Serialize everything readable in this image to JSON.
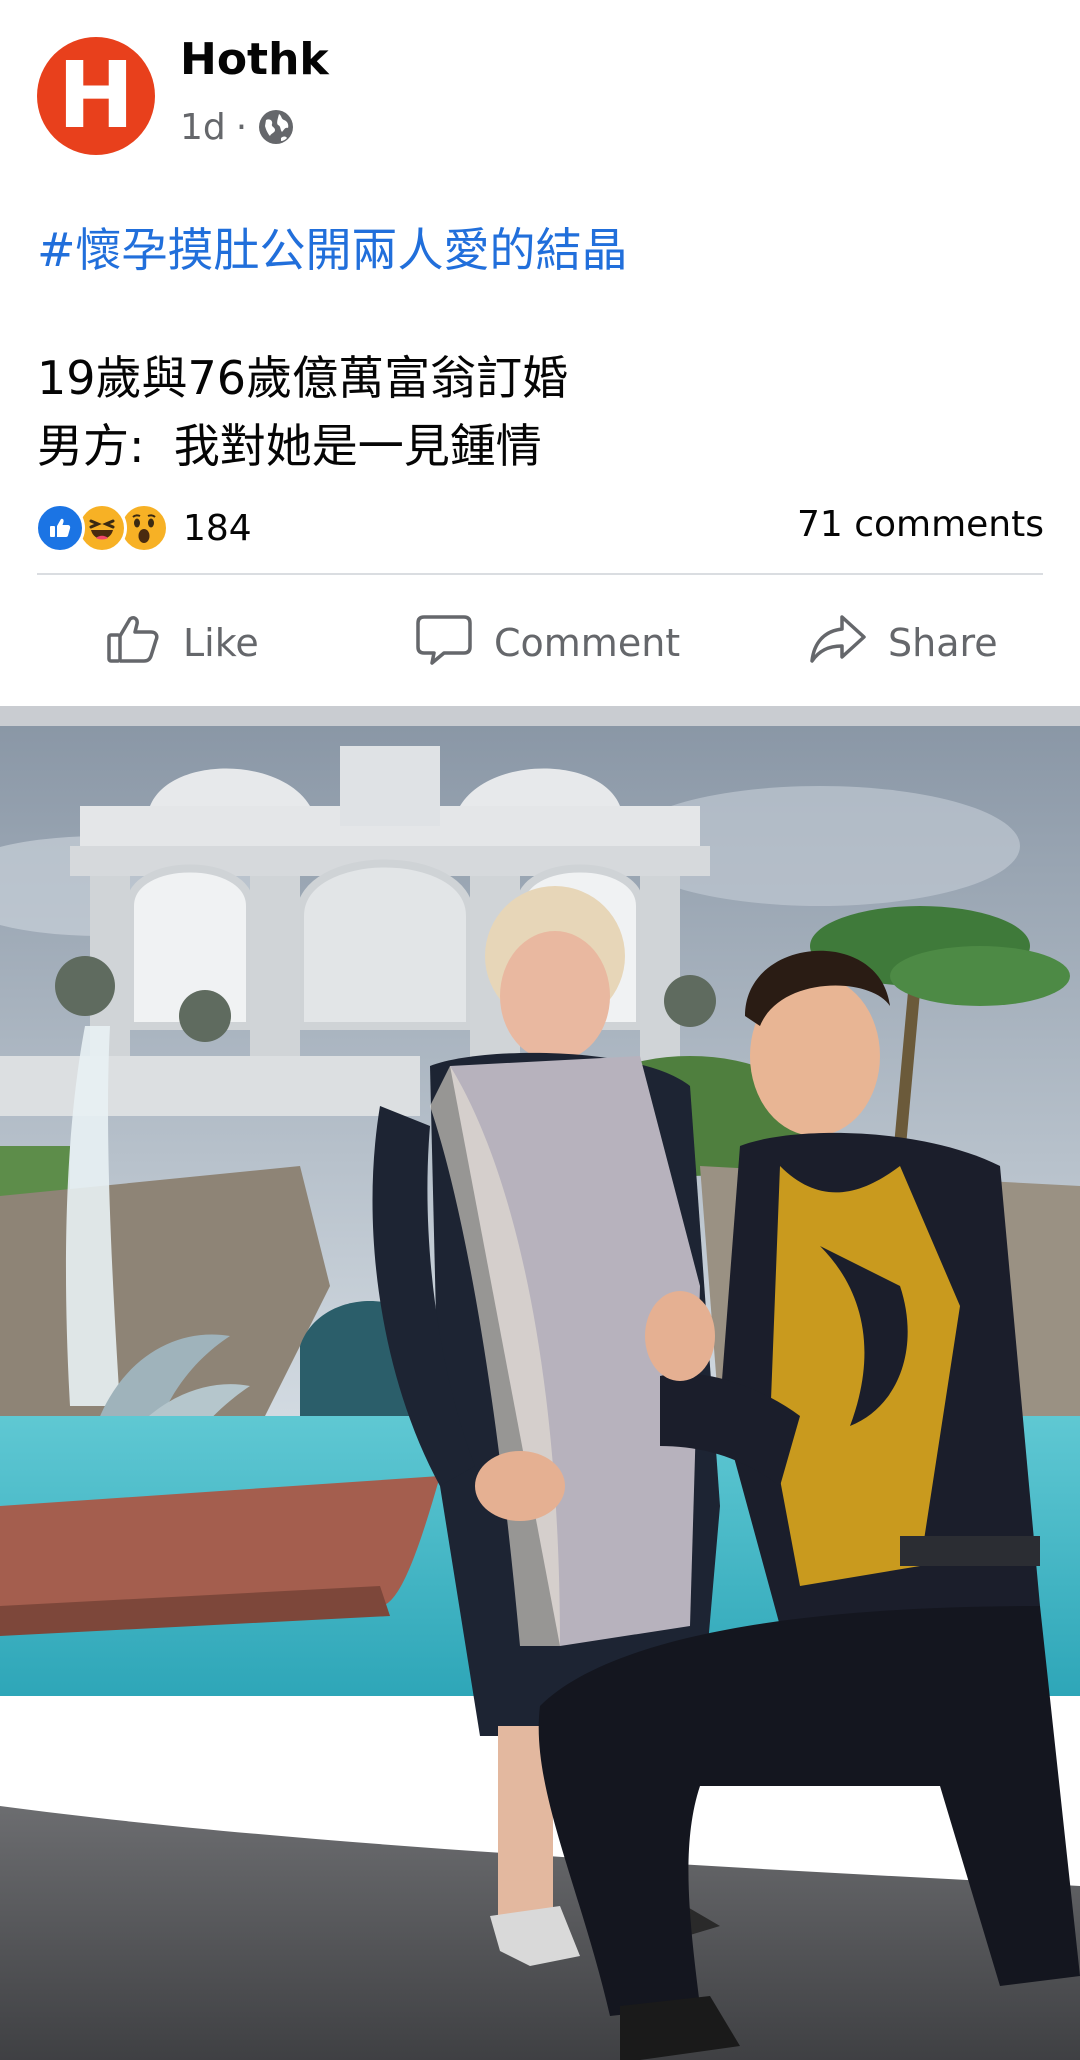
{
  "post": {
    "author": "Hothk",
    "avatar_letter": "H",
    "time": "1d",
    "separator": "·",
    "visibility_icon": "globe-icon",
    "hashtag": "#懷孕摸肚公開兩人愛的結晶",
    "body_line_1": "19歲與76歲億萬富翁訂婚",
    "body_line_2": "男方:  我對她是一見鍾情",
    "reaction_icons": [
      "like-icon",
      "haha-icon",
      "wow-icon"
    ],
    "reaction_count": "184",
    "comments_count": "71 comments"
  },
  "actions": {
    "like": "Like",
    "comment": "Comment",
    "share": "Share"
  },
  "colors": {
    "link": "#216fdb",
    "avatar": "#e8401c",
    "like_blue": "#1b74e4",
    "muted": "#65676b"
  }
}
